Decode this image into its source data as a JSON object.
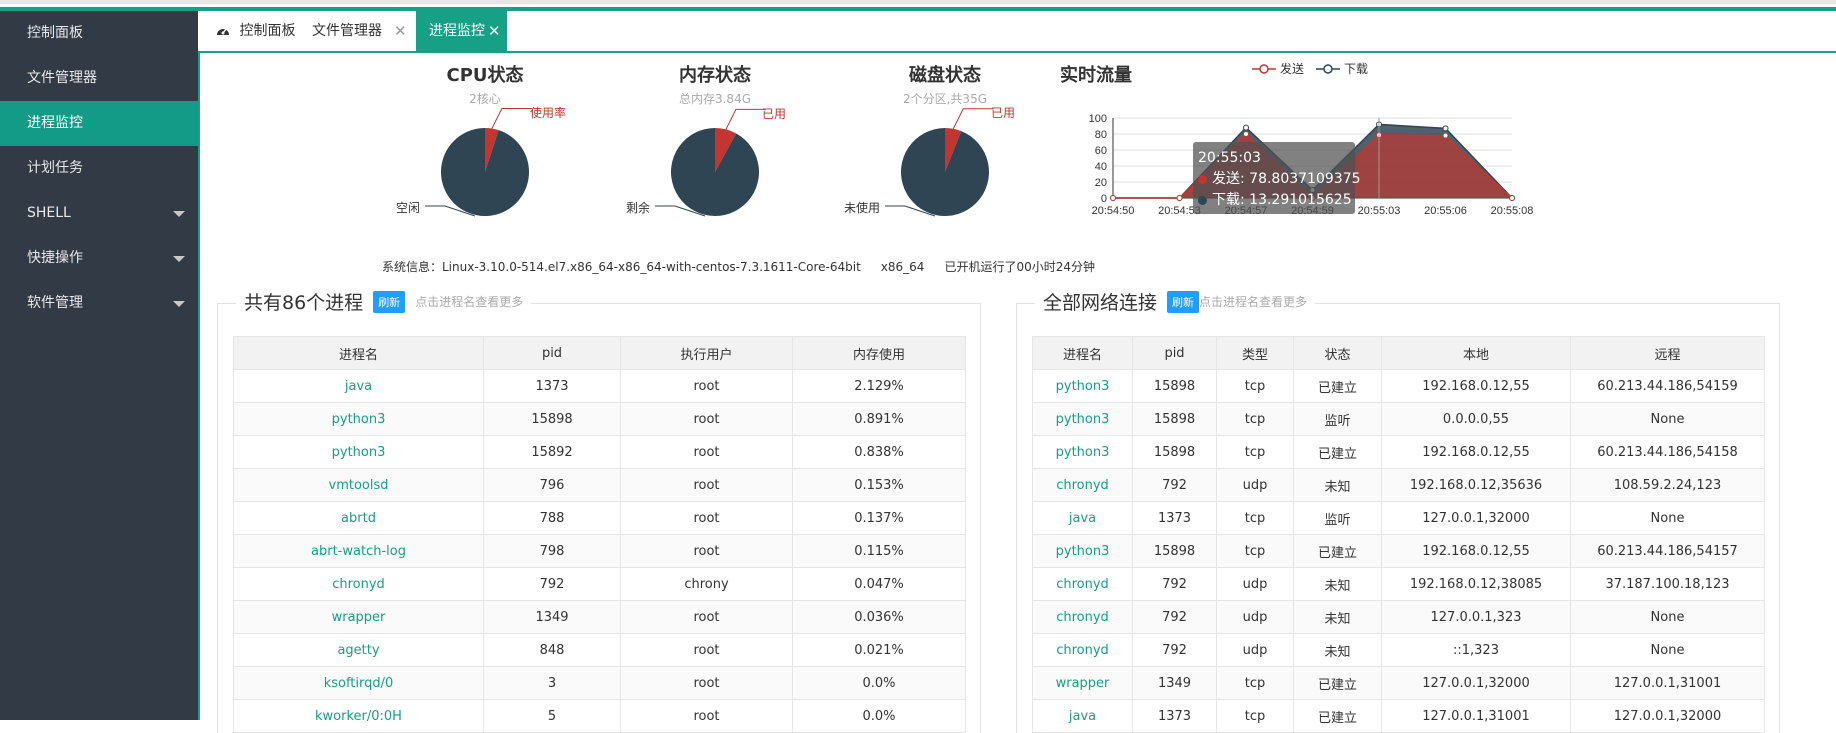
{
  "colors": {
    "accent": "#16a085",
    "sidebar": "#323a46",
    "pie_dark": "#2f4554",
    "pie_red": "#c23531",
    "refresh": "#1e9fff"
  },
  "sidebar": {
    "items": [
      {
        "label": "控制面板",
        "active": false,
        "has_caret": false
      },
      {
        "label": "文件管理器",
        "active": false,
        "has_caret": false
      },
      {
        "label": "进程监控",
        "active": true,
        "has_caret": false
      },
      {
        "label": "计划任务",
        "active": false,
        "has_caret": false
      },
      {
        "label": "SHELL",
        "active": false,
        "has_caret": true
      },
      {
        "label": "快捷操作",
        "active": false,
        "has_caret": true
      },
      {
        "label": "软件管理",
        "active": false,
        "has_caret": true
      }
    ]
  },
  "tabs": [
    {
      "label": "控制面板",
      "icon": "dashboard-icon",
      "closable": false,
      "active": false
    },
    {
      "label": "文件管理器",
      "closable": true,
      "active": false
    },
    {
      "label": "进程监控",
      "closable": true,
      "active": true
    }
  ],
  "tab_close_glyph": "✕",
  "cpu": {
    "title": "CPU状态",
    "subtitle": "2核心",
    "used_label": "使用率",
    "free_label": "空闲"
  },
  "memory": {
    "title": "内存状态",
    "subtitle": "总内存3.84G",
    "used_label": "已用",
    "free_label": "剩余"
  },
  "disk": {
    "title": "磁盘状态",
    "subtitle": "2个分区,共35G",
    "used_label": "已用",
    "free_label": "未使用"
  },
  "chart_data": [
    {
      "type": "pie",
      "title": "CPU状态",
      "subtitle": "2核心",
      "slices": [
        {
          "name": "使用率",
          "value": 5
        },
        {
          "name": "空闲",
          "value": 95
        }
      ]
    },
    {
      "type": "pie",
      "title": "内存状态",
      "subtitle": "总内存3.84G",
      "slices": [
        {
          "name": "已用",
          "value": 8
        },
        {
          "name": "剩余",
          "value": 92
        }
      ]
    },
    {
      "type": "pie",
      "title": "磁盘状态",
      "subtitle": "2个分区,共35G",
      "slices": [
        {
          "name": "已用",
          "value": 6
        },
        {
          "name": "未使用",
          "value": 94
        }
      ]
    },
    {
      "type": "area",
      "title": "实时流量",
      "categories": [
        "20:54:50",
        "20:54:53",
        "20:54:57",
        "20:54:59",
        "20:55:03",
        "20:55:06",
        "20:55:08"
      ],
      "series": [
        {
          "name": "发送",
          "values": [
            0,
            0,
            80,
            0,
            78.8037109375,
            78,
            0
          ]
        },
        {
          "name": "下载",
          "values": [
            0,
            0,
            88,
            10,
            92,
            87,
            0
          ]
        }
      ],
      "ylim": [
        0,
        100
      ],
      "yticks": [
        0,
        20,
        40,
        60,
        80,
        100
      ],
      "legend": "top"
    }
  ],
  "traffic": {
    "title": "实时流量",
    "legend_send": "发送",
    "legend_download": "下载",
    "yticks": [
      "100",
      "80",
      "60",
      "40",
      "20",
      "0"
    ],
    "xticks": [
      "20:54:50",
      "20:54:53",
      "20:54:57",
      "20:54:59",
      "20:55:03",
      "20:55:06",
      "20:55:08"
    ],
    "tooltip": {
      "time": "20:55:03",
      "send": "发送: 78.8037109375",
      "download": "下载: 13.291015625"
    }
  },
  "sysinfo": {
    "os": "系统信息：Linux-3.10.0-514.el7.x86_64-x86_64-with-centos-7.3.1611-Core-64bit",
    "arch": "x86_64",
    "uptime": "已开机运行了00小时24分钟"
  },
  "process_panel": {
    "title": "共有86个进程",
    "refresh": "刷新",
    "hint": "点击进程名查看更多",
    "headers": [
      "进程名",
      "pid",
      "执行用户",
      "内存使用"
    ],
    "rows": [
      [
        "java",
        "1373",
        "root",
        "2.129%"
      ],
      [
        "python3",
        "15898",
        "root",
        "0.891%"
      ],
      [
        "python3",
        "15892",
        "root",
        "0.838%"
      ],
      [
        "vmtoolsd",
        "796",
        "root",
        "0.153%"
      ],
      [
        "abrtd",
        "788",
        "root",
        "0.137%"
      ],
      [
        "abrt-watch-log",
        "798",
        "root",
        "0.115%"
      ],
      [
        "chronyd",
        "792",
        "chrony",
        "0.047%"
      ],
      [
        "wrapper",
        "1349",
        "root",
        "0.036%"
      ],
      [
        "agetty",
        "848",
        "root",
        "0.021%"
      ],
      [
        "ksoftirqd/0",
        "3",
        "root",
        "0.0%"
      ],
      [
        "kworker/0:0H",
        "5",
        "root",
        "0.0%"
      ]
    ]
  },
  "network_panel": {
    "title": "全部网络连接",
    "refresh": "刷新",
    "hint": "点击进程名查看更多",
    "headers": [
      "进程名",
      "pid",
      "类型",
      "状态",
      "本地",
      "远程"
    ],
    "rows": [
      [
        "python3",
        "15898",
        "tcp",
        "已建立",
        "192.168.0.12,55",
        "60.213.44.186,54159"
      ],
      [
        "python3",
        "15898",
        "tcp",
        "监听",
        "0.0.0.0,55",
        "None"
      ],
      [
        "python3",
        "15898",
        "tcp",
        "已建立",
        "192.168.0.12,55",
        "60.213.44.186,54158"
      ],
      [
        "chronyd",
        "792",
        "udp",
        "未知",
        "192.168.0.12,35636",
        "108.59.2.24,123"
      ],
      [
        "java",
        "1373",
        "tcp",
        "监听",
        "127.0.0.1,32000",
        "None"
      ],
      [
        "python3",
        "15898",
        "tcp",
        "已建立",
        "192.168.0.12,55",
        "60.213.44.186,54157"
      ],
      [
        "chronyd",
        "792",
        "udp",
        "未知",
        "192.168.0.12,38085",
        "37.187.100.18,123"
      ],
      [
        "chronyd",
        "792",
        "udp",
        "未知",
        "127.0.0.1,323",
        "None"
      ],
      [
        "chronyd",
        "792",
        "udp",
        "未知",
        "::1,323",
        "None"
      ],
      [
        "wrapper",
        "1349",
        "tcp",
        "已建立",
        "127.0.0.1,32000",
        "127.0.0.1,31001"
      ],
      [
        "java",
        "1373",
        "tcp",
        "已建立",
        "127.0.0.1,31001",
        "127.0.0.1,32000"
      ]
    ]
  }
}
